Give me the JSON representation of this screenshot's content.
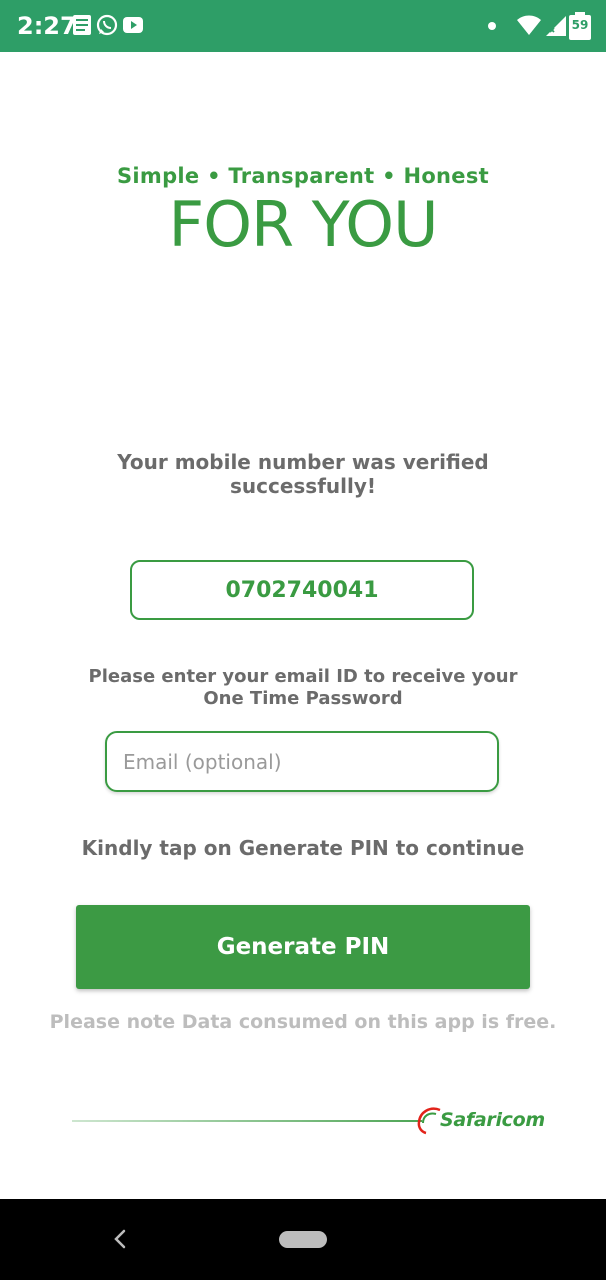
{
  "status_bar": {
    "time": "2:27",
    "battery": "59",
    "icons": [
      "notification-icon",
      "whatsapp-icon",
      "youtube-icon",
      "dot-icon",
      "wifi-icon",
      "signal-icon",
      "battery-icon"
    ],
    "background_color": "#2e9e67"
  },
  "logo": {
    "tagline": "Simple • Transparent • Honest",
    "headline": "FOR YOU",
    "color": "#3a9b42"
  },
  "verification": {
    "message": "Your mobile number was  verified successfully!",
    "mobile_number": "0702740041"
  },
  "email": {
    "instruction": "Please enter your email ID to receive your One Time Password",
    "placeholder": "Email (optional)",
    "value": ""
  },
  "actions": {
    "tap_note": "Kindly tap on Generate PIN to continue",
    "generate_label": "Generate PIN",
    "data_note": "Please note Data consumed on this app is free."
  },
  "footer": {
    "brand": "Safaricom"
  },
  "nav_bar": {
    "icons": [
      "back-icon",
      "home-icon"
    ]
  }
}
